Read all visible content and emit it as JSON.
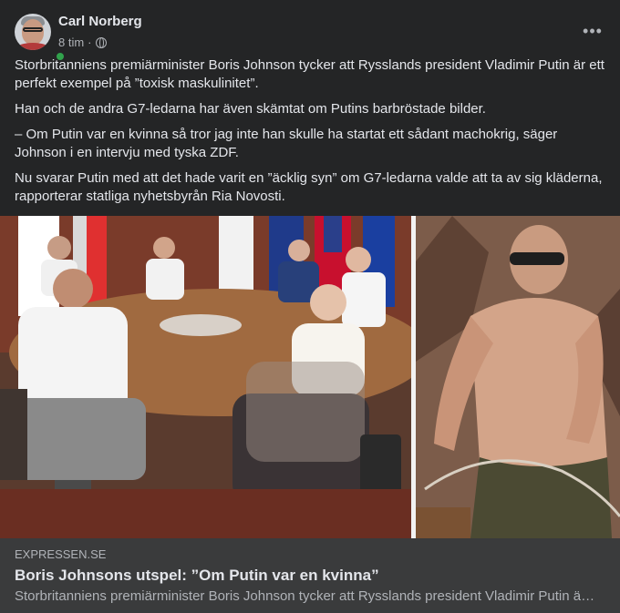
{
  "post": {
    "author": "Carl Norberg",
    "time": "8 tim",
    "separator": "·",
    "privacy_icon": "globe-icon",
    "more_icon": "more-horizontal-icon",
    "more_label": "•••",
    "paragraphs": [
      "Storbritanniens premiärminister Boris Johnson tycker att Rysslands president Vladimir Putin är ett perfekt exempel på ”toxisk maskulinitet”.",
      "Han och de andra G7-ledarna har även skämtat om Putins barbröstade bilder.",
      "– Om Putin var en kvinna så tror jag inte han skulle ha startat ett sådant machokrig, säger Johnson i en intervju med tyska ZDF.",
      "Nu svarar Putin med att det hade varit en ”äcklig syn” om G7-ledarna valde att ta av sig kläderna, rapporterar statliga nyhetsbyrån Ria Novosti."
    ]
  },
  "link": {
    "domain": "EXPRESSEN.SE",
    "title": "Boris Johnsons utspel: ”Om Putin var en kvinna”",
    "description": "Storbritanniens premiärminister Boris Johnson tycker att Rysslands president Vladimir Putin ä…"
  },
  "colors": {
    "background": "#242526",
    "text_primary": "#e4e6eb",
    "text_secondary": "#b0b3b8",
    "online": "#31a24c",
    "link_bg": "#3a3b3c"
  }
}
